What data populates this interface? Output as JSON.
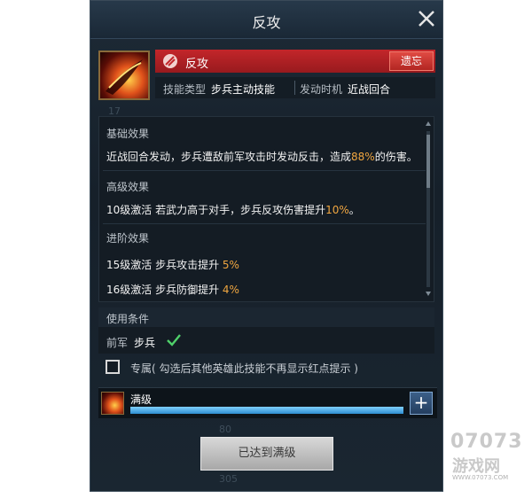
{
  "window": {
    "title": "反攻"
  },
  "skill": {
    "name": "反攻",
    "forget_label": "遗忘",
    "type_label": "技能类型",
    "type_value": "步兵主动技能",
    "timing_label": "发动时机",
    "timing_value": "近战回合"
  },
  "effects": {
    "base_header": "基础效果",
    "base_pre": "近战回合发动，步兵遭敌前军攻击时发动反击，造成",
    "base_hl": "88%",
    "base_post": "的伤害。",
    "adv_header": "高级效果",
    "adv_pre": "10级激活 若武力高于对手，步兵反攻伤害提升",
    "adv_hl": "10%",
    "adv_post": "。",
    "rank_header": "进阶效果",
    "rank1_pre": "15级激活  步兵攻击提升 ",
    "rank1_hl": "5%",
    "rank2_pre": "16级激活  步兵防御提升 ",
    "rank2_hl": "4%"
  },
  "condition": {
    "header": "使用条件",
    "label": "前军",
    "value": "步兵"
  },
  "focus": {
    "label": "专属( 勾选后其他英雄此技能不再显示红点提示 )",
    "checked": false
  },
  "level": {
    "label": "满级",
    "progress": 1.0,
    "plus_label": "+"
  },
  "max_button": {
    "label": "已达到满级"
  },
  "background_ghost": {
    "a": "17",
    "b": "80",
    "c": "305"
  },
  "watermark": {
    "line1": "07073",
    "line2": "游戏网",
    "line3": "WWW.07073.COM"
  },
  "colors": {
    "accent_red": "#c3262a",
    "highlight": "#f0a640",
    "progress": "#4aa8e8"
  },
  "icons": {
    "close": "close-icon",
    "check": "checkmark-icon",
    "plus": "plus-icon",
    "emblem": "skill-emblem-icon"
  }
}
